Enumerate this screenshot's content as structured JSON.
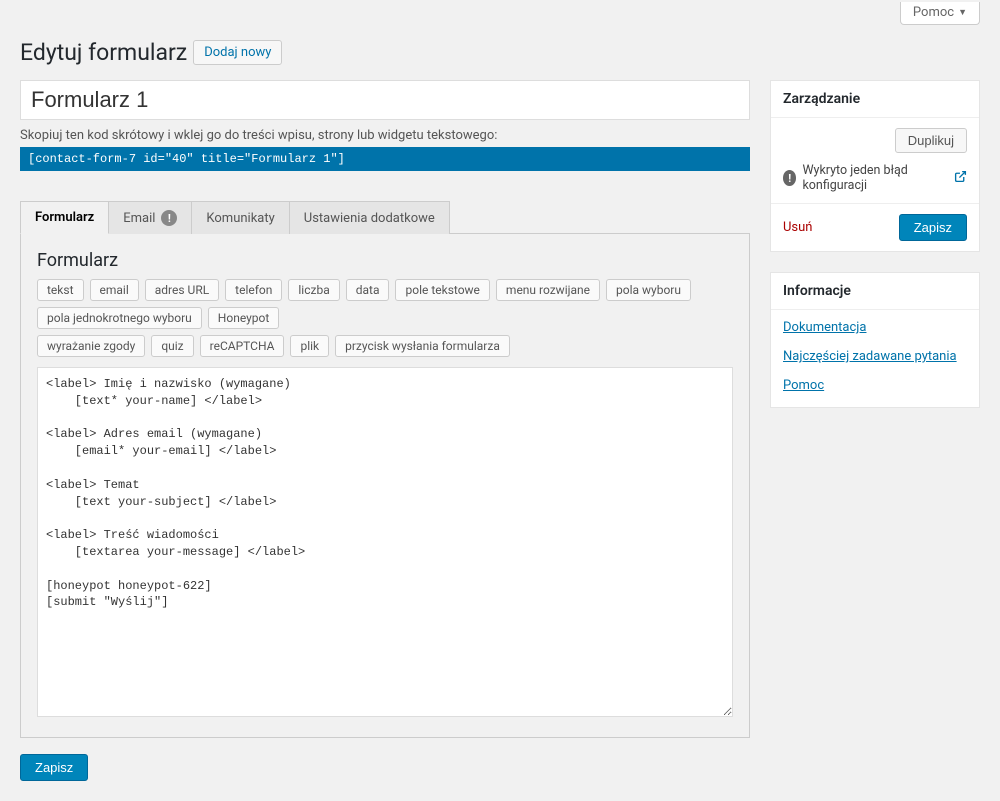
{
  "screen_options": {
    "label": "Pomoc"
  },
  "header": {
    "title": "Edytuj formularz",
    "add_new": "Dodaj nowy"
  },
  "form": {
    "title_value": "Formularz 1",
    "shortcode_hint": "Skopiuj ten kod skrótowy i wklej go do treści wpisu, strony lub widgetu tekstowego:",
    "shortcode": "[contact-form-7 id=\"40\" title=\"Formularz 1\"]"
  },
  "tabs": {
    "form": "Formularz",
    "email": "Email",
    "messages": "Komunikaty",
    "additional": "Ustawienia dodatkowe"
  },
  "panel": {
    "heading": "Formularz",
    "tags_row1": [
      "tekst",
      "email",
      "adres URL",
      "telefon",
      "liczba",
      "data",
      "pole tekstowe",
      "menu rozwijane",
      "pola wyboru",
      "pola jednokrotnego wyboru",
      "Honeypot"
    ],
    "tags_row2": [
      "wyrażanie zgody",
      "quiz",
      "reCAPTCHA",
      "plik",
      "przycisk wysłania formularza"
    ],
    "editor_value": "<label> Imię i nazwisko (wymagane)\n    [text* your-name] </label>\n\n<label> Adres email (wymagane)\n    [email* your-email] </label>\n\n<label> Temat\n    [text your-subject] </label>\n\n<label> Treść wiadomości\n    [textarea your-message] </label>\n\n[honeypot honeypot-622]\n[submit \"Wyślij\"]"
  },
  "buttons": {
    "save": "Zapisz",
    "duplicate": "Duplikuj",
    "delete": "Usuń"
  },
  "sidebar": {
    "manage_title": "Zarządzanie",
    "config_warning": "Wykryto jeden błąd konfiguracji",
    "info_title": "Informacje",
    "links": {
      "docs": "Dokumentacja",
      "faq": "Najczęściej zadawane pytania",
      "help": "Pomoc"
    }
  }
}
